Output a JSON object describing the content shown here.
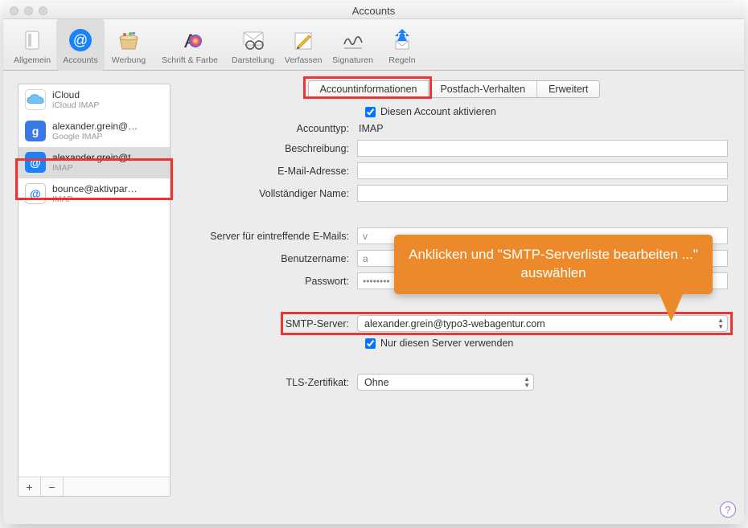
{
  "window_title": "Accounts",
  "toolbar": [
    {
      "id": "allgemein",
      "label": "Allgemein"
    },
    {
      "id": "accounts",
      "label": "Accounts",
      "selected": true
    },
    {
      "id": "werbung",
      "label": "Werbung"
    },
    {
      "id": "schrift",
      "label": "Schrift & Farbe"
    },
    {
      "id": "darstellung",
      "label": "Darstellung"
    },
    {
      "id": "verfassen",
      "label": "Verfassen"
    },
    {
      "id": "signaturen",
      "label": "Signaturen"
    },
    {
      "id": "regeln",
      "label": "Regeln"
    }
  ],
  "sidebar": {
    "accounts": [
      {
        "name": "iCloud",
        "sub": "iCloud IMAP",
        "icon": "icloud"
      },
      {
        "name": "alexander.grein@…",
        "sub": "Google IMAP",
        "icon": "google"
      },
      {
        "name": "alexander.grein@t…",
        "sub": "IMAP",
        "icon": "at",
        "selected": true
      },
      {
        "name": "bounce@aktivpar…",
        "sub": "IMAP",
        "icon": "atwhite"
      }
    ],
    "add": "+",
    "remove": "−"
  },
  "tabs": {
    "info": "Accountinformationen",
    "postfach": "Postfach-Verhalten",
    "erweitert": "Erweitert"
  },
  "form": {
    "activate_label": "Diesen Account aktivieren",
    "type_label": "Accounttyp:",
    "type_value": "IMAP",
    "desc_label": "Beschreibung:",
    "desc_value": "                                                  ",
    "email_label": "E-Mail-Adresse:",
    "email_value": "                                                  ",
    "fullname_label": "Vollständiger Name:",
    "fullname_value": "                         ",
    "incoming_label": "Server für eintreffende E-Mails:",
    "incoming_value": "v",
    "user_label": "Benutzername:",
    "user_value": "a",
    "pass_label": "Passwort:",
    "pass_value": "••••••••",
    "smtp_label": "SMTP-Server:",
    "smtp_value": "alexander.grein@typo3-webagentur.com",
    "only_server_label": "Nur diesen Server verwenden",
    "tls_label": "TLS-Zertifikat:",
    "tls_value": "Ohne"
  },
  "callout": "Anklicken und \"SMTP-Serverliste bearbeiten ...\" auswählen",
  "help": "?"
}
